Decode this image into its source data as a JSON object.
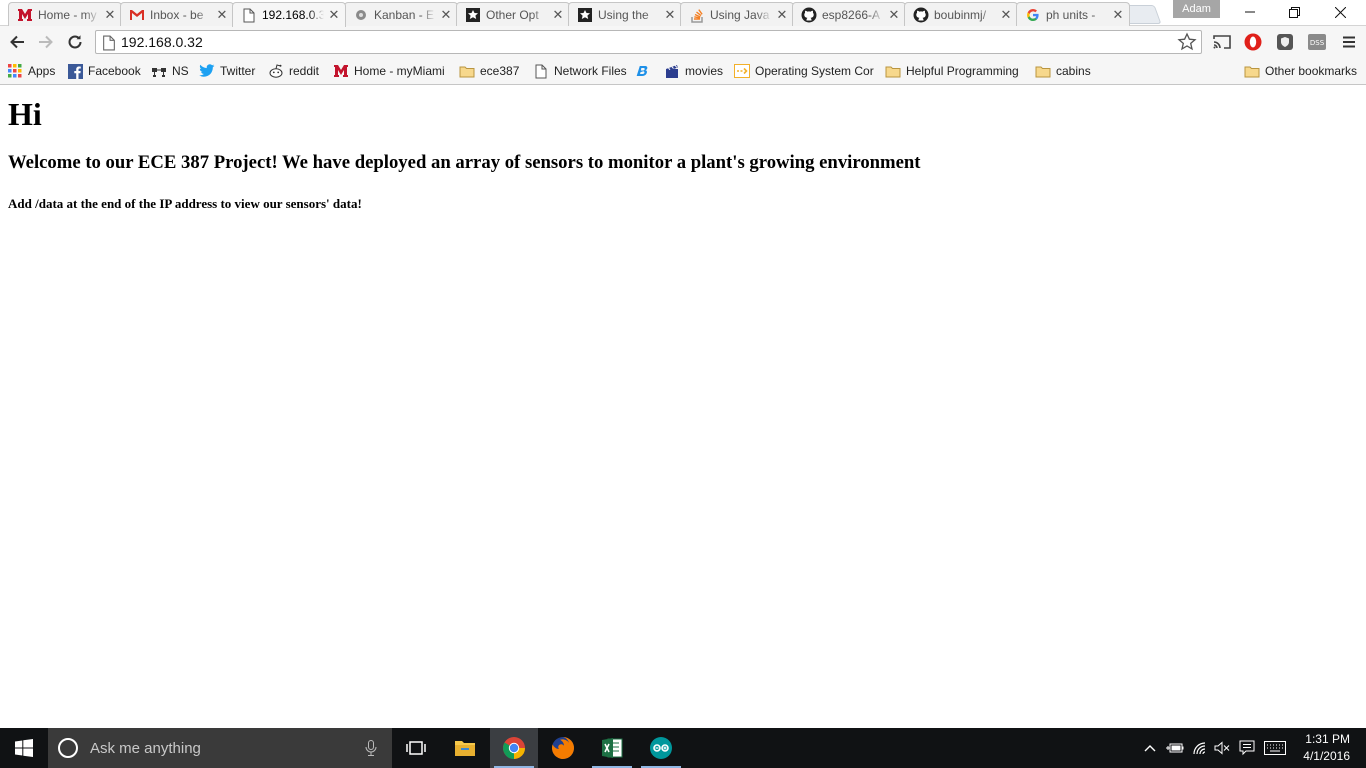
{
  "browser": {
    "tabs": [
      {
        "label": "Home - my",
        "favicon": "miami-m-icon"
      },
      {
        "label": "Inbox - be",
        "favicon": "gmail-icon"
      },
      {
        "label": "192.168.0.3",
        "favicon": "page-icon",
        "active": true
      },
      {
        "label": "Kanban - E",
        "favicon": "kanban-icon"
      },
      {
        "label": "Other Opt",
        "favicon": "puzzle-icon"
      },
      {
        "label": "Using the",
        "favicon": "puzzle-icon"
      },
      {
        "label": "Using Java",
        "favicon": "stackoverflow-icon"
      },
      {
        "label": "esp8266-A",
        "favicon": "github-icon"
      },
      {
        "label": "boubinmj/",
        "favicon": "github-icon"
      },
      {
        "label": "ph units -",
        "favicon": "google-icon"
      }
    ],
    "profile_name": "Adam",
    "url": "192.168.0.32",
    "bookmarks": [
      {
        "label": "Apps",
        "icon": "apps-grid-icon"
      },
      {
        "label": "Facebook",
        "icon": "facebook-icon"
      },
      {
        "label": "NS",
        "icon": "network-icon"
      },
      {
        "label": "Twitter",
        "icon": "twitter-icon"
      },
      {
        "label": "reddit",
        "icon": "reddit-icon"
      },
      {
        "label": "Home - myMiami",
        "icon": "miami-m-icon"
      },
      {
        "label": "ece387",
        "icon": "folder-icon"
      },
      {
        "label": "Network Files",
        "icon": "page-icon"
      },
      {
        "label": "",
        "icon": "bing-icon"
      },
      {
        "label": "movies",
        "icon": "clapper-icon"
      },
      {
        "label": "Operating System Cor",
        "icon": "arrow-icon"
      },
      {
        "label": "Helpful Programming",
        "icon": "folder-icon"
      },
      {
        "label": "cabins",
        "icon": "folder-icon"
      }
    ],
    "other_bookmarks": "Other bookmarks"
  },
  "page": {
    "h1": "Hi",
    "h3": "Welcome to our ECE 387 Project! We have deployed an array of sensors to monitor a plant's growing environment",
    "h5": "Add /data at the end of the IP address to view our sensors' data!"
  },
  "taskbar": {
    "search_placeholder": "Ask me anything",
    "time": "1:31 PM",
    "date": "4/1/2016"
  },
  "colors": {
    "chrome_bg": "#f6f6f6",
    "taskbar_bg": "#101214",
    "cortana_bg": "#3a3a3a",
    "active_app_underline": "#8fb6e3"
  }
}
